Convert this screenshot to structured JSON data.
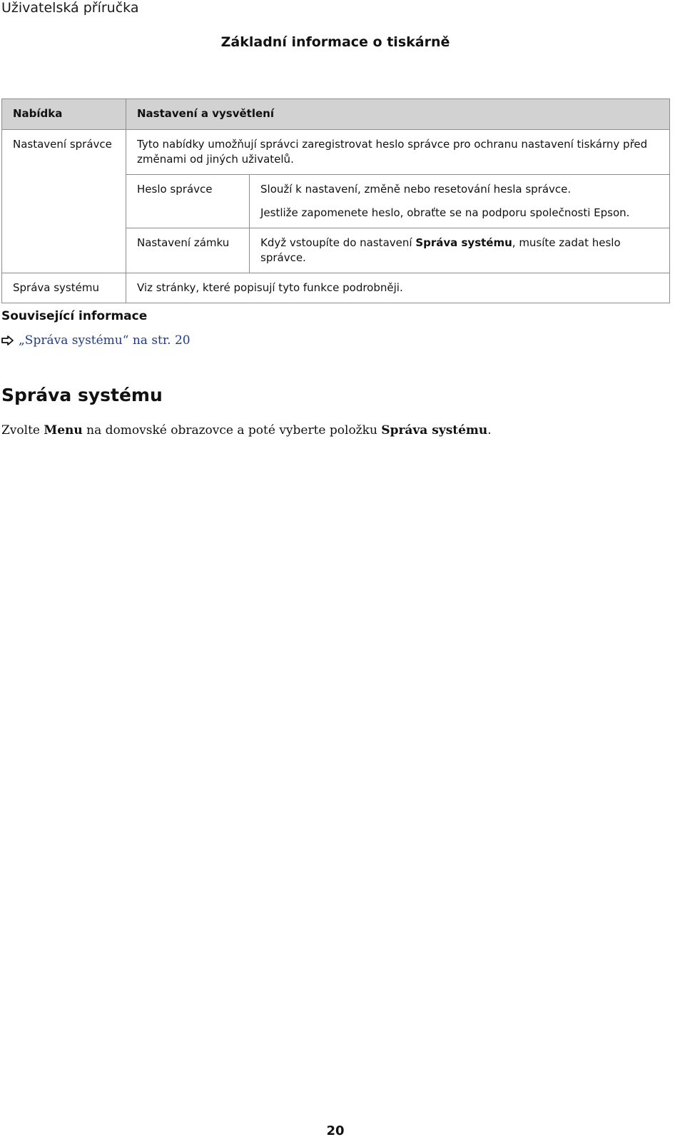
{
  "header": {
    "running_title": "Uživatelská příručka"
  },
  "section": {
    "heading": "Základní informace o tiskárně"
  },
  "table": {
    "headers": [
      "Nabídka",
      "Nastavení a vysvětlení"
    ],
    "admin_settings": {
      "label": "Nastavení správce",
      "description": "Tyto nabídky umožňují správci zaregistrovat heslo správce pro ochranu nastavení tiskárny před změnami od jiných uživatelů.",
      "password": {
        "label": "Heslo správce",
        "line1": "Slouží k nastavení, změně nebo resetování hesla správce.",
        "line2": "Jestliže zapomenete heslo, obraťte se na podporu společnosti Epson."
      },
      "lock": {
        "label": "Nastavení zámku",
        "text_before": "Když vstoupíte do nastavení ",
        "text_bold": "Správa systému",
        "text_after": ", musíte zadat heslo správce."
      }
    },
    "system_admin": {
      "label": "Správa systému",
      "description": "Viz stránky, které popisují tyto funkce podrobněji."
    }
  },
  "related": {
    "title": "Související informace",
    "link_text": "„Správa systému“ na str. 20"
  },
  "system_section": {
    "title": "Správa systému",
    "text_1": "Zvolte ",
    "bold_1": "Menu",
    "text_2": " na domovské obrazovce a poté vyberte položku ",
    "bold_2": "Správa systému",
    "text_3": "."
  },
  "footer": {
    "page_number": "20"
  }
}
